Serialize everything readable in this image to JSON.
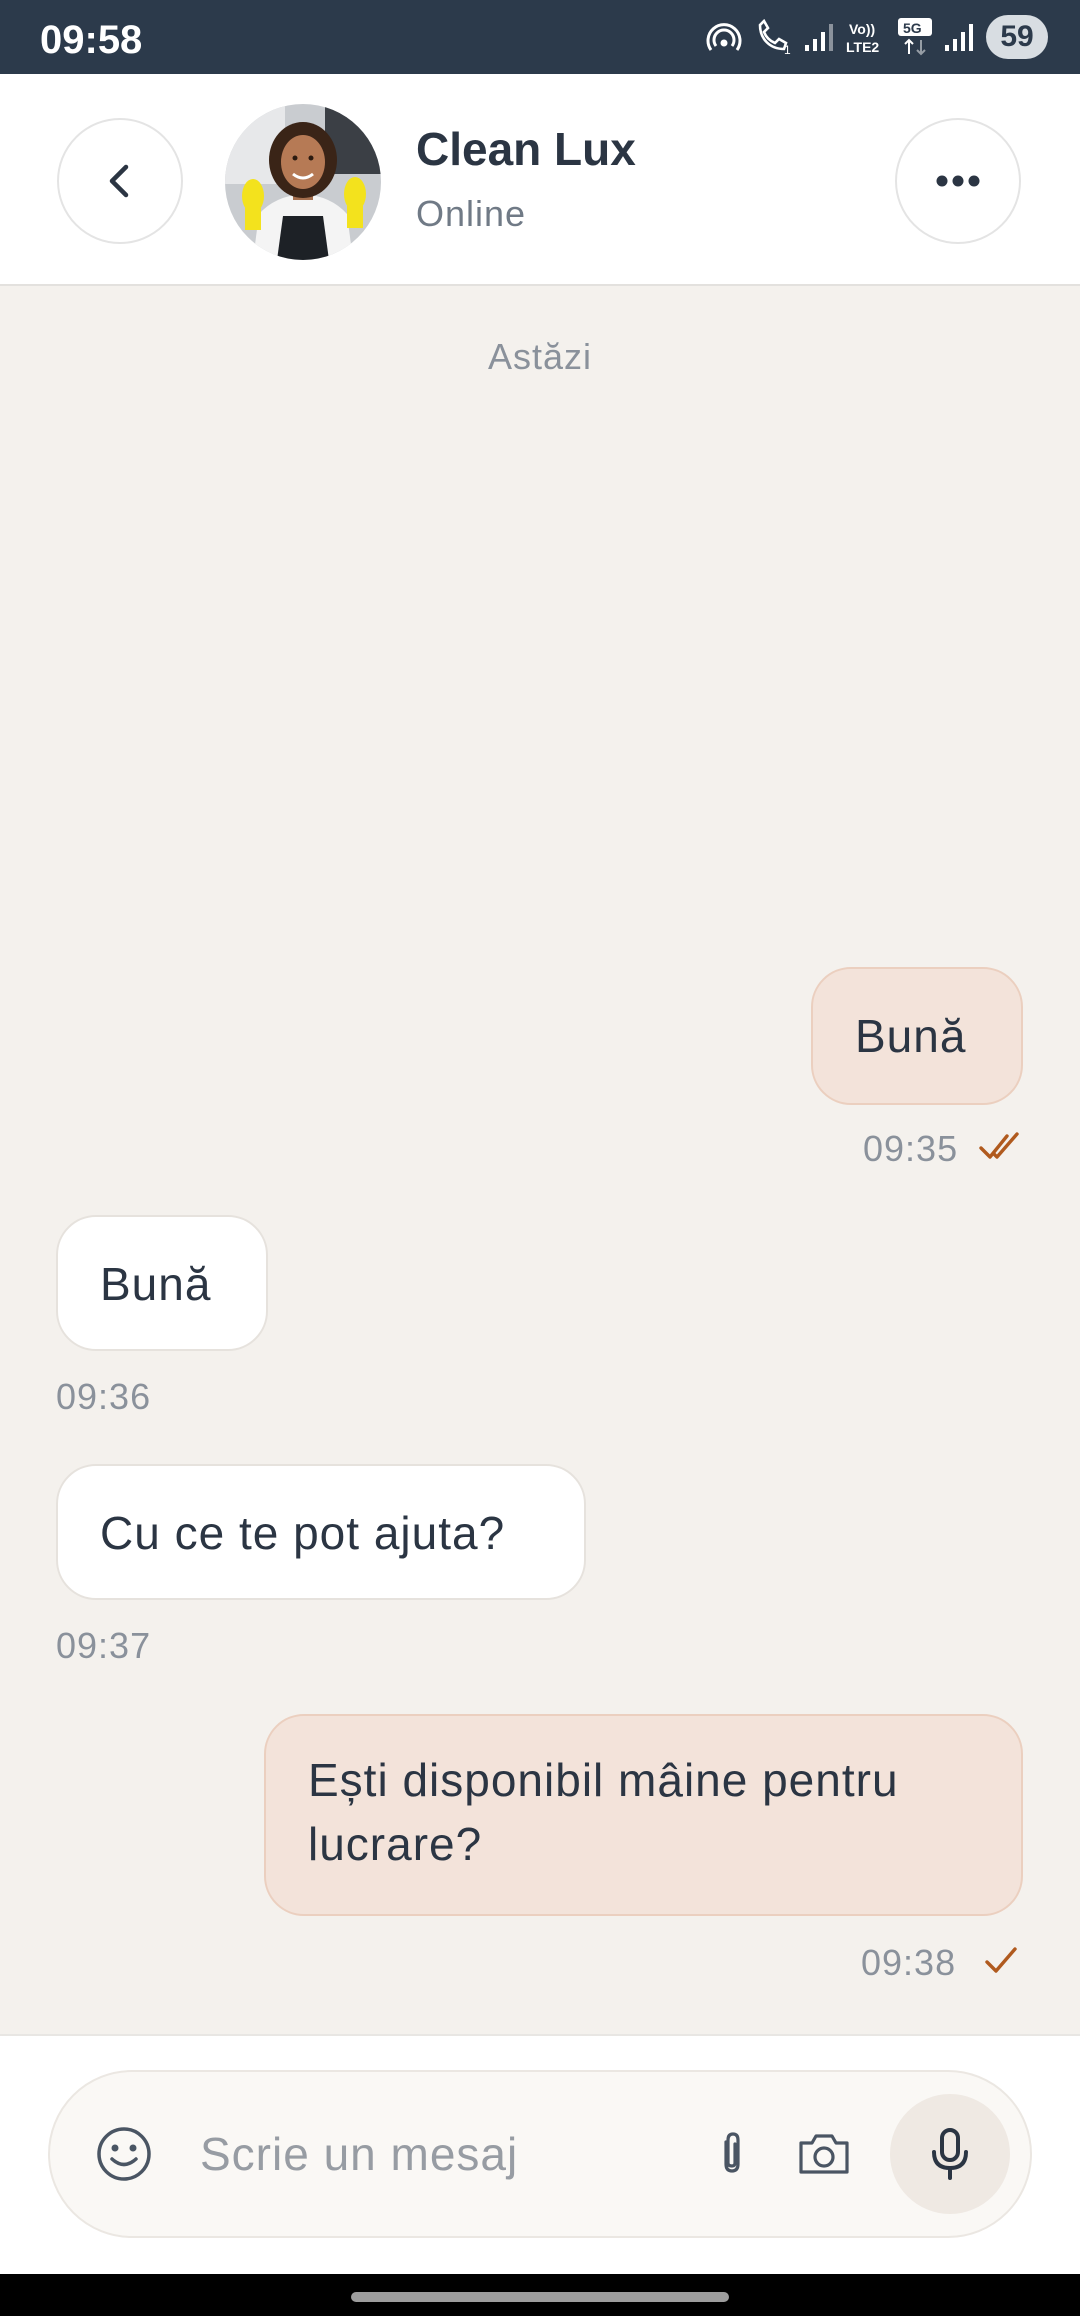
{
  "status_bar": {
    "time": "09:58",
    "battery": "59",
    "icons": [
      "hotspot-icon",
      "wifi-call-icon",
      "signal-icon",
      "volte-lte2-icon",
      "5g-icon",
      "signal-icon",
      "battery-icon"
    ]
  },
  "header": {
    "contact_name": "Clean Lux",
    "contact_status": "Online",
    "back_icon": "chevron-left-icon",
    "more_icon": "more-horizontal-icon"
  },
  "chat": {
    "date_divider": "Astăzi",
    "messages": [
      {
        "direction": "outgoing",
        "text": "Bună",
        "time": "09:35",
        "status": "read"
      },
      {
        "direction": "incoming",
        "text": "Bună",
        "time": "09:36"
      },
      {
        "direction": "incoming",
        "text": "Cu ce te pot ajuta?",
        "time": "09:37"
      },
      {
        "direction": "outgoing",
        "text": "Ești disponibil mâine pentru lucrare?",
        "time": "09:38",
        "status": "sent"
      }
    ]
  },
  "composer": {
    "placeholder": "Scrie un mesaj",
    "value": "",
    "icons": [
      "emoji-icon",
      "paperclip-icon",
      "camera-icon",
      "microphone-icon"
    ]
  },
  "colors": {
    "status_bar_bg": "#2c3a4b",
    "chat_bg": "#f4f1ed",
    "outgoing_bubble": "#f3e3da",
    "incoming_bubble": "#ffffff",
    "tick_color": "#b05a1e"
  }
}
